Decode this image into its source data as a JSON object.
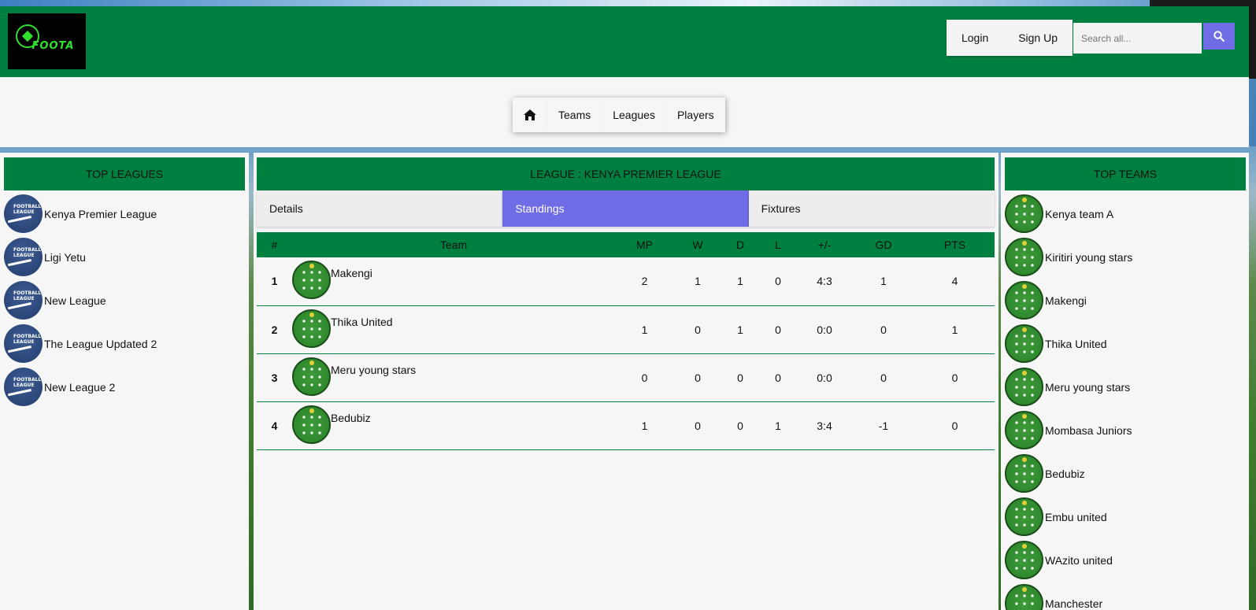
{
  "header": {
    "logo_text": "FOOTA",
    "login_label": "Login",
    "signup_label": "Sign Up",
    "search_placeholder": "Search all..."
  },
  "nav": {
    "items": [
      {
        "label": "Teams"
      },
      {
        "label": "Leagues"
      },
      {
        "label": "Players"
      }
    ]
  },
  "left": {
    "title": "TOP LEAGUES",
    "items": [
      {
        "label": "Kenya Premier League"
      },
      {
        "label": "Ligi Yetu"
      },
      {
        "label": "New League"
      },
      {
        "label": "The League Updated 2"
      },
      {
        "label": "New League 2"
      }
    ]
  },
  "main": {
    "title": "LEAGUE : KENYA PREMIER LEAGUE",
    "tabs": [
      {
        "label": "Details",
        "active": false
      },
      {
        "label": "Standings",
        "active": true
      },
      {
        "label": "Fixtures",
        "active": false
      }
    ],
    "table": {
      "headers": [
        "#",
        "Team",
        "MP",
        "W",
        "D",
        "L",
        "+/-",
        "GD",
        "PTS"
      ],
      "rows": [
        {
          "pos": "1",
          "team": "Makengi",
          "mp": "2",
          "w": "1",
          "d": "1",
          "l": "0",
          "goals": "4:3",
          "gd": "1",
          "pts": "4"
        },
        {
          "pos": "2",
          "team": "Thika United",
          "mp": "1",
          "w": "0",
          "d": "1",
          "l": "0",
          "goals": "0:0",
          "gd": "0",
          "pts": "1"
        },
        {
          "pos": "3",
          "team": "Meru young stars",
          "mp": "0",
          "w": "0",
          "d": "0",
          "l": "0",
          "goals": "0:0",
          "gd": "0",
          "pts": "0"
        },
        {
          "pos": "4",
          "team": "Bedubiz",
          "mp": "1",
          "w": "0",
          "d": "0",
          "l": "1",
          "goals": "3:4",
          "gd": "-1",
          "pts": "0"
        }
      ]
    }
  },
  "right": {
    "title": "TOP TEAMS",
    "items": [
      {
        "label": "Kenya team A"
      },
      {
        "label": "Kiritiri young stars"
      },
      {
        "label": "Makengi"
      },
      {
        "label": "Thika United"
      },
      {
        "label": "Meru young stars"
      },
      {
        "label": "Mombasa Juniors"
      },
      {
        "label": "Bedubiz"
      },
      {
        "label": "Embu united"
      },
      {
        "label": "WAzito united"
      },
      {
        "label": "Manchester"
      }
    ]
  },
  "colors": {
    "brand_green": "#008040",
    "accent_purple": "#6f6ce6",
    "panel_bg": "#f6f6f6"
  }
}
